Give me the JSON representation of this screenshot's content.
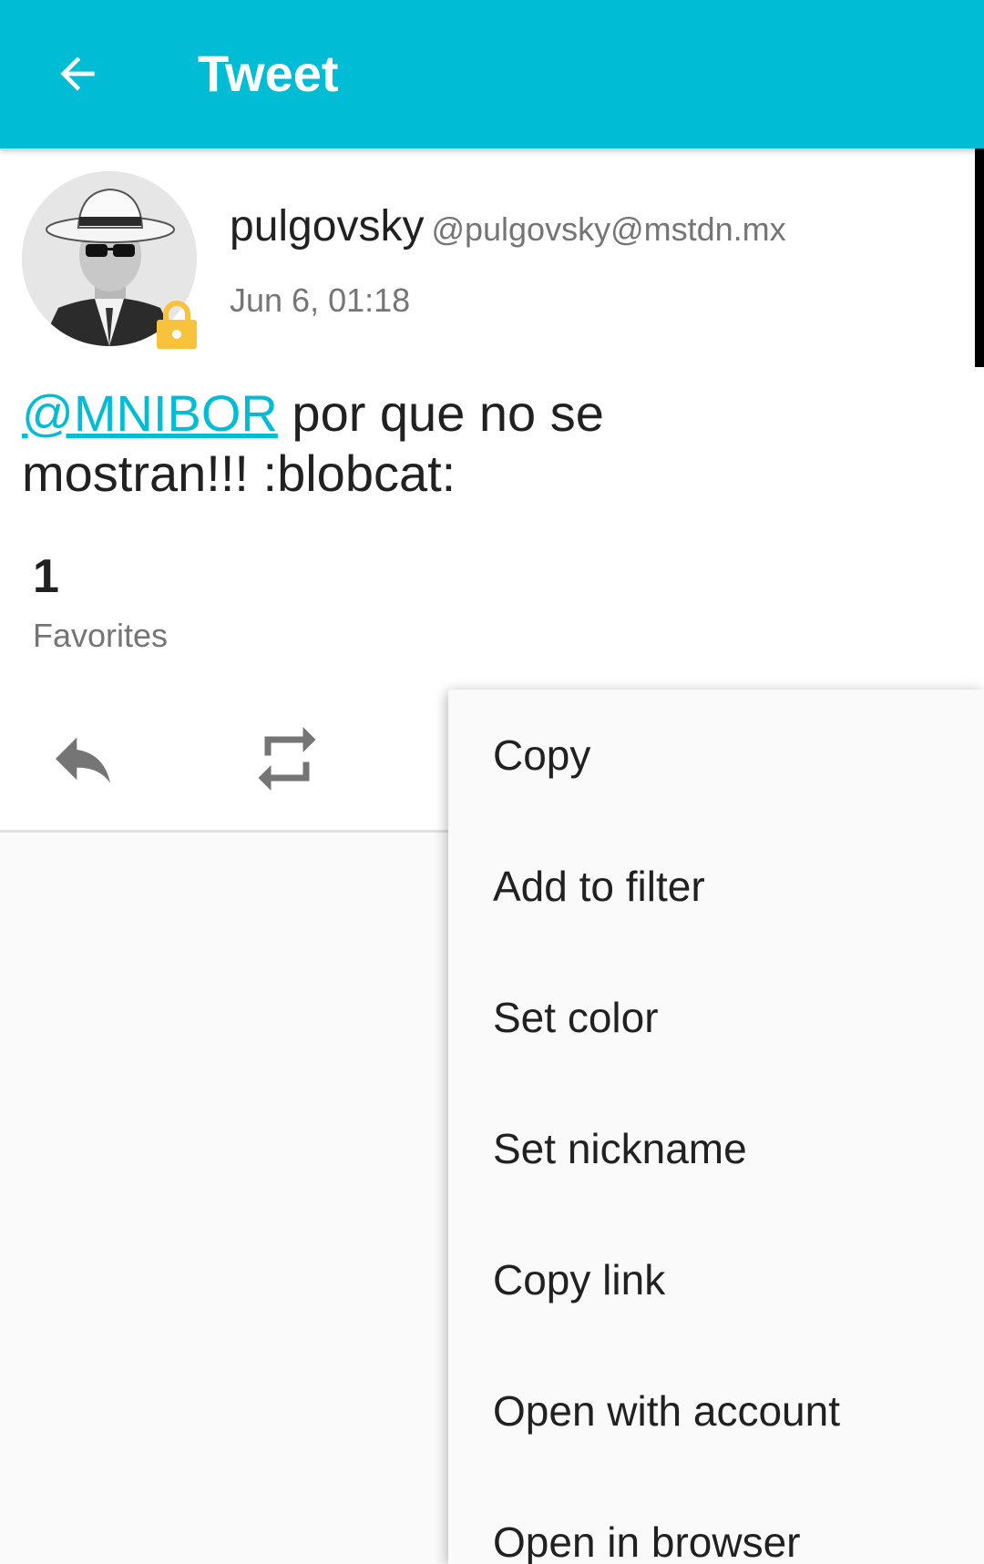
{
  "appbar": {
    "title": "Tweet",
    "back_icon": "arrow-back-icon",
    "color": "#00bcd4"
  },
  "status": {
    "display_name": "pulgovsky",
    "acct": "@pulgovsky@mstdn.mx",
    "timestamp": "Jun 6, 01:18",
    "mention": "@MNIBOR",
    "text": " por que no se mostran!!! :blobcat:",
    "mention_color": "#00bcd4",
    "locked_icon": "lock-icon",
    "lock_color": "#f9c23c"
  },
  "stats": {
    "favorites_count": "1",
    "favorites_label": "Favorites"
  },
  "actions": {
    "reply_icon": "reply-icon",
    "boost_icon": "boost-icon"
  },
  "menu": {
    "items": [
      {
        "label": "Copy"
      },
      {
        "label": "Add to filter"
      },
      {
        "label": "Set color"
      },
      {
        "label": "Set nickname"
      },
      {
        "label": "Copy link"
      },
      {
        "label": "Open with account"
      },
      {
        "label": "Open in browser"
      }
    ]
  }
}
